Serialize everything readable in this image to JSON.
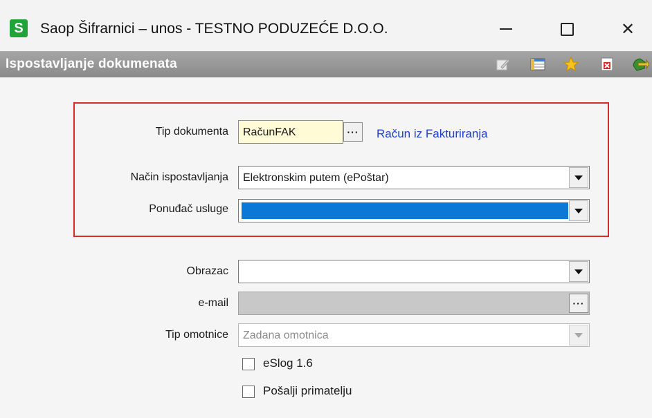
{
  "window": {
    "logo_letter": "S",
    "title": "Saop Šifrarnici – unos - TESTNO PODUZEĆE D.O.O.",
    "controls": {
      "minimize": "",
      "maximize": "",
      "close": "✕"
    }
  },
  "header": {
    "title": "Ispostavljanje dokumenata",
    "toolbar_icons": [
      "edit-icon",
      "table-icon",
      "star-icon",
      "close-document-icon",
      "exit-icon"
    ]
  },
  "form": {
    "tip_dokumenta": {
      "label": "Tip dokumenta",
      "value": "RačunFAK",
      "dots": "···",
      "description": "Račun iz Fakturiranja",
      "bg_color": "#fffbd6"
    },
    "nacin_ispostavljanja": {
      "label": "Način ispostavljanja",
      "value": "Elektronskim putem (ePoštar)"
    },
    "ponudjac_usluge": {
      "label": "Ponuđač usluge",
      "value": "",
      "selected_color": "#0a78d4"
    },
    "obrazac": {
      "label": "Obrazac",
      "value": ""
    },
    "email": {
      "label": "e-mail",
      "value": "",
      "dots": "···",
      "disabled_color": "#c8c8c8"
    },
    "tip_omotnice": {
      "label": "Tip omotnice",
      "value": "Zadana omotnica"
    },
    "eslog": {
      "label": "eSlog 1.6",
      "checked": false
    },
    "posalji": {
      "label": "Pošalji primatelju",
      "checked": false
    }
  },
  "colors": {
    "highlight_border": "#d52b2b",
    "link": "#1d3fd0",
    "header_bg": "#9a9a9a"
  }
}
